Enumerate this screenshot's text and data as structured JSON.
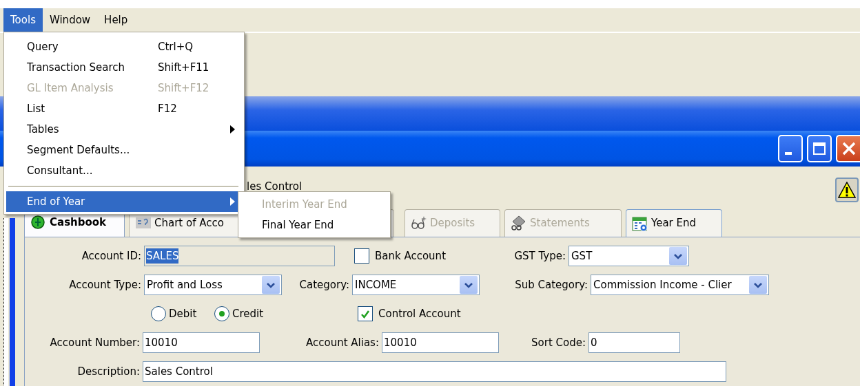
{
  "menubar": [
    {
      "label": "Tools",
      "selected": true
    },
    {
      "label": "Window",
      "selected": false
    },
    {
      "label": "Help",
      "selected": false
    }
  ],
  "tools_menu": {
    "items": [
      {
        "kind": "item",
        "label": "Query",
        "shortcut": "Ctrl+Q",
        "disabled": false,
        "selected": false
      },
      {
        "kind": "item",
        "label": "Transaction Search",
        "shortcut": "Shift+F11",
        "disabled": false,
        "selected": false
      },
      {
        "kind": "item",
        "label": "GL Item Analysis",
        "shortcut": "Shift+F12",
        "disabled": true,
        "selected": false
      },
      {
        "kind": "item",
        "label": "List",
        "shortcut": "F12",
        "disabled": false,
        "selected": false
      },
      {
        "kind": "submenu",
        "label": "Tables",
        "disabled": false,
        "selected": false
      },
      {
        "kind": "item",
        "label": "Segment Defaults...",
        "disabled": false,
        "selected": false
      },
      {
        "kind": "item",
        "label": "Consultant...",
        "disabled": false,
        "selected": false
      },
      {
        "kind": "separator"
      },
      {
        "kind": "submenu",
        "label": "End of Year",
        "disabled": false,
        "selected": true
      }
    ]
  },
  "submenu": {
    "items": [
      {
        "label": "Interim Year End",
        "disabled": true
      },
      {
        "label": "Final Year End",
        "disabled": false
      }
    ]
  },
  "header_text": "les Control",
  "tabs": [
    {
      "label": "Cashbook",
      "selected": true,
      "disabled": false
    },
    {
      "label": "Chart of Acco",
      "selected": false,
      "disabled": false
    },
    {
      "label": "Deposits",
      "selected": false,
      "disabled": true
    },
    {
      "label": "Statements",
      "selected": false,
      "disabled": true
    },
    {
      "label": "Year End",
      "selected": false,
      "disabled": false
    }
  ],
  "form": {
    "rows": [
      [
        {
          "kind": "text",
          "label": "Account ID:",
          "value": "SALES",
          "text_selected": true
        },
        {
          "kind": "checkbox",
          "label": "Bank Account",
          "checked": false
        },
        {
          "kind": "select",
          "label": "GST Type:",
          "value": "GST"
        }
      ],
      [
        {
          "kind": "select",
          "label": "Account Type:",
          "value": "Profit and Loss"
        },
        {
          "kind": "select",
          "label": "Category:",
          "value": "INCOME"
        },
        {
          "kind": "select",
          "label": "Sub Category:",
          "value": "Commission Income - Clier"
        }
      ],
      [
        {
          "kind": "radio",
          "label": "Debit",
          "selected": false
        },
        {
          "kind": "radio",
          "label": "Credit",
          "selected": true
        },
        {
          "kind": "checkbox",
          "label": "Control Account",
          "checked": true
        }
      ],
      [
        {
          "kind": "text",
          "label": "Account Number:",
          "value": "10010",
          "text_selected": false
        },
        {
          "kind": "text",
          "label": "Account Alias:",
          "value": "10010",
          "text_selected": false
        },
        {
          "kind": "text",
          "label": "Sort Code:",
          "value": "0",
          "text_selected": false
        }
      ],
      [
        {
          "kind": "text",
          "label": "Description:",
          "value": "Sales Control",
          "text_selected": false
        }
      ]
    ]
  }
}
